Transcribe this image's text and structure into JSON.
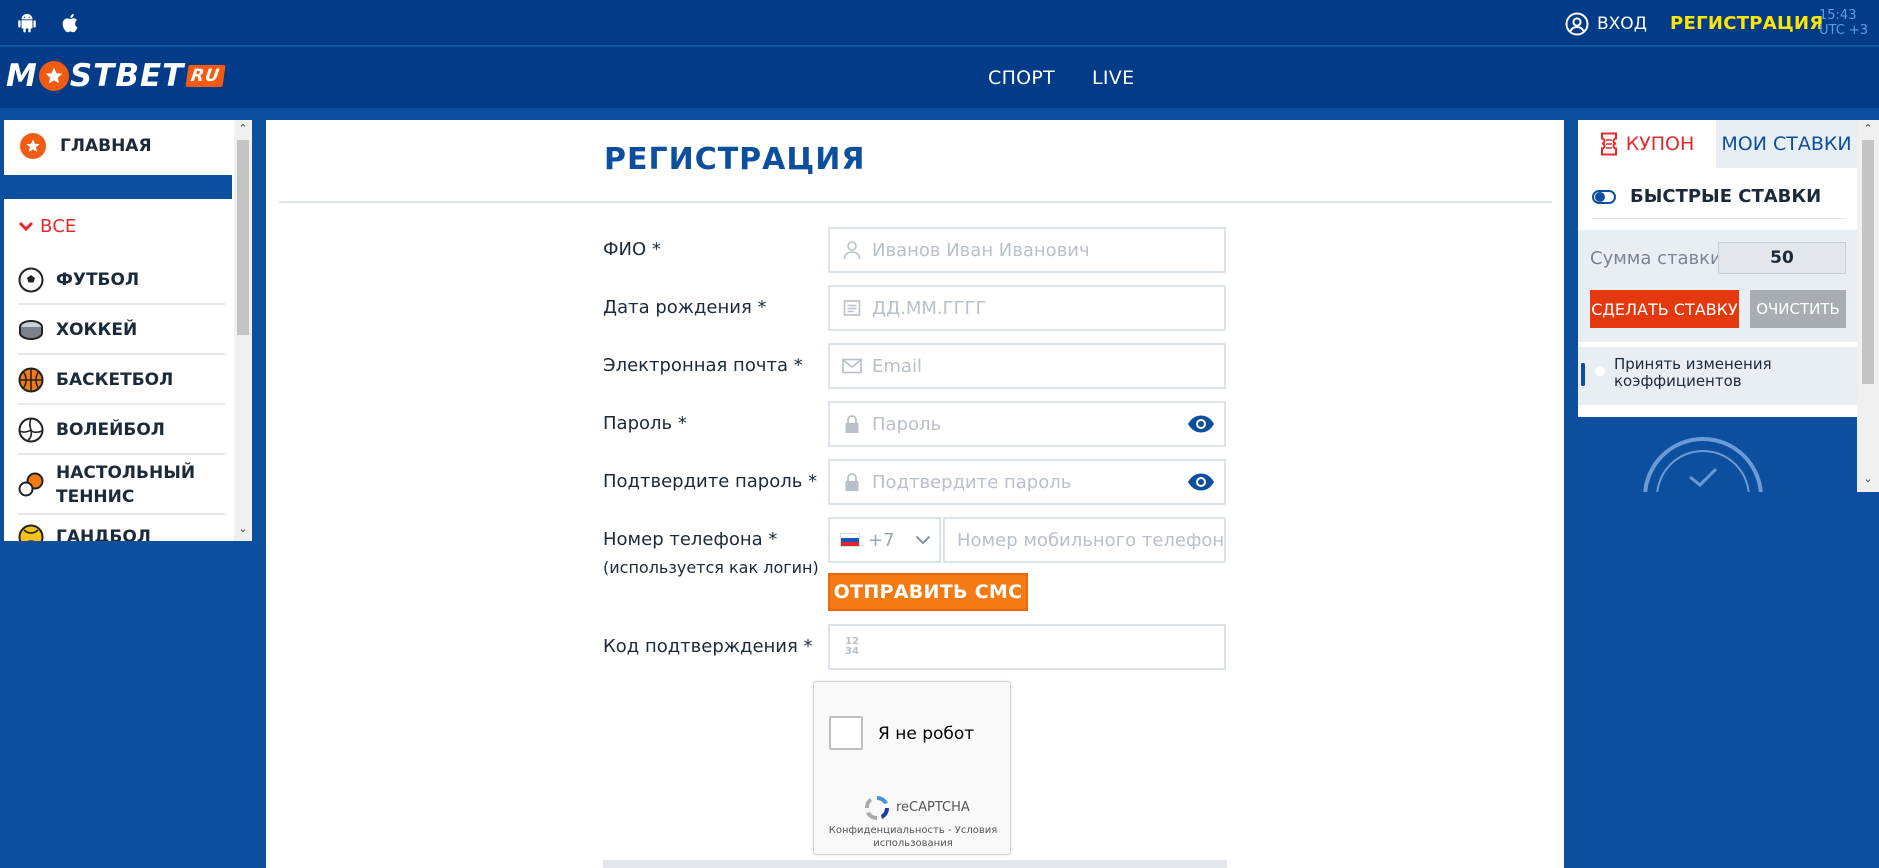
{
  "topbar": {
    "platform_icons": [
      "android-icon",
      "apple-icon"
    ],
    "login_label": "ВХОД",
    "register_label": "РЕГИСТРАЦИЯ",
    "time": "15:43",
    "timezone": "UTC +3"
  },
  "header": {
    "logo_text_left": "M",
    "logo_text_right": "STBET",
    "logo_badge": "RU",
    "nav": [
      "СПОРТ",
      "LIVE"
    ]
  },
  "sidebar": {
    "home_label": "ГЛАВНАЯ",
    "all_label": "ВСЕ",
    "sports": [
      {
        "label": "ФУТБОЛ",
        "icon": "football-icon"
      },
      {
        "label": "ХОККЕЙ",
        "icon": "hockey-puck-icon"
      },
      {
        "label": "БАСКЕТБОЛ",
        "icon": "basketball-icon"
      },
      {
        "label": "ВОЛЕЙБОЛ",
        "icon": "volleyball-icon"
      },
      {
        "label": "НАСТОЛЬНЫЙ ТЕННИС",
        "icon": "table-tennis-icon"
      },
      {
        "label": "ГАНДБОЛ",
        "icon": "handball-icon"
      }
    ]
  },
  "registration": {
    "title": "РЕГИСТРАЦИЯ",
    "fields": {
      "name": {
        "label": "ФИО *",
        "placeholder": "Иванов Иван Иванович"
      },
      "birthdate": {
        "label": "Дата рождения *",
        "placeholder": "ДД.ММ.ГГГГ"
      },
      "email": {
        "label": "Электронная почта *",
        "placeholder": "Email"
      },
      "password": {
        "label": "Пароль *",
        "placeholder": "Пароль"
      },
      "confirm": {
        "label": "Подтвердите пароль *",
        "placeholder": "Подтвердите пароль"
      },
      "phone": {
        "label": "Номер телефона *",
        "sublabel": "(используется как логин)",
        "country_code": "+7",
        "placeholder": "Номер мобильного телефона"
      },
      "code": {
        "label": "Код подтверждения *",
        "placeholder_top": "12",
        "placeholder_bottom": "34"
      }
    },
    "send_sms_label": "ОТПРАВИТЬ СМС",
    "captcha": {
      "checkbox_label": "Я не робот",
      "brand": "reCAPTCHA",
      "privacy": "Конфиденциальность",
      "sep": " - ",
      "terms": "Условия использования"
    }
  },
  "coupon": {
    "tab_coupon": "КУПОН",
    "tab_my_bets": "МОИ СТАВКИ",
    "quick_bets_label": "БЫСТРЫЕ СТАВКИ",
    "quick_bets_on": false,
    "stake_label": "Сумма ставки",
    "stake_value": "50",
    "make_bet_label": "СДЕЛАТЬ СТАВКУ",
    "clear_label": "ОЧИСТИТЬ",
    "accept_changes_label": "Принять изменения коэффициентов",
    "accept_changes_on": true
  },
  "colors": {
    "brand_blue": "#0d4f9f",
    "accent_orange": "#f45b12",
    "register_yellow": "#ffe500",
    "danger_red": "#e4282b"
  }
}
